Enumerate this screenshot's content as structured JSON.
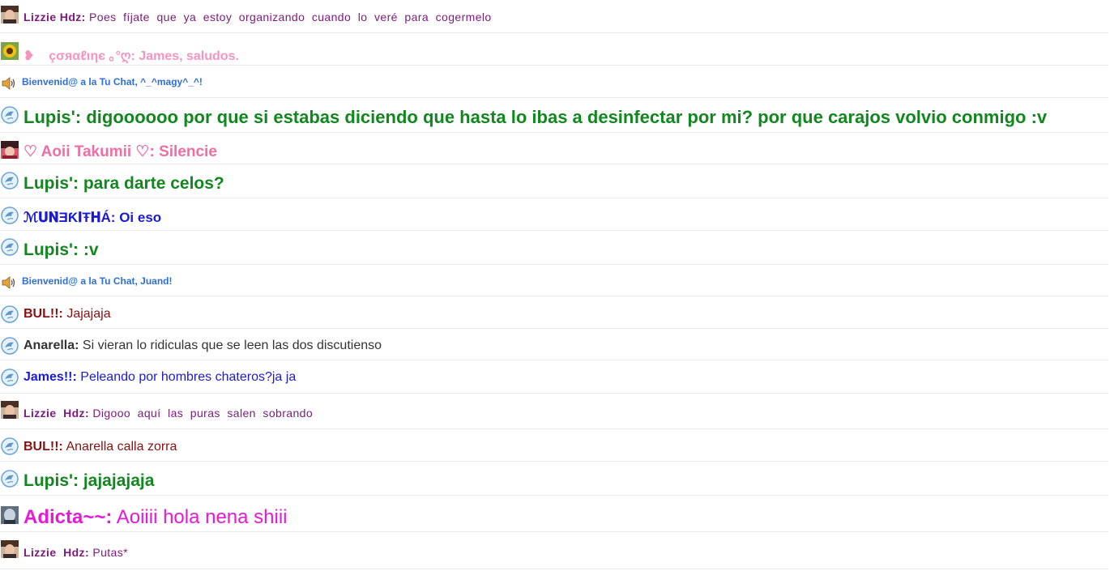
{
  "chat": {
    "messages": [
      {
        "user": "Lizzie  Hdz:",
        "text": "Poes  fíjate  que  ya  estoy  organizando  cuando  lo  veré  para  cogermelo",
        "icon": "avatar-photo",
        "name_color": "#7d1a7d",
        "text_color": "#7d1a7d"
      },
      {
        "user": "❥    çσяαℓιηє ｡°ღ:",
        "text": "James, saludos.",
        "icon": "sunflower-avatar",
        "name_color": "#f594c0",
        "text_color": "#f594c0"
      },
      {
        "text": "Bienvenid@ a la Tu Chat, ^_^magy^_^!",
        "icon": "speaker-icon",
        "system": true,
        "text_color": "#2e6fd6"
      },
      {
        "user": "Lupis':",
        "text": "digoooooo por que si estabas diciendo que hasta lo ibas a desinfectar por mi? por que carajos volvio conmigo :v",
        "icon": "dolphin-icon",
        "name_color": "#12861f",
        "text_color": "#12861f"
      },
      {
        "user": "♡ Aoii Takumii ♡:",
        "text": "Silencie",
        "icon": "avatar-photo",
        "name_color": "#ee6fa1",
        "text_color": "#ee6fa1"
      },
      {
        "user": "Lupis':",
        "text": "para darte celos?",
        "icon": "dolphin-icon",
        "name_color": "#12861f",
        "text_color": "#12861f"
      },
      {
        "user": "ℳ𝐔𝐍̀ƎƘ𝐈Ŧ𝐇Á:",
        "text": "Oi eso",
        "icon": "dolphin-icon",
        "name_color": "#1a1ad6",
        "text_color": "#1a1ad6"
      },
      {
        "user": "Lupis':",
        "text": ":v",
        "icon": "dolphin-icon",
        "name_color": "#12861f",
        "text_color": "#12861f"
      },
      {
        "text": "Bienvenid@ a la Tu Chat, Juand!",
        "icon": "speaker-icon",
        "system": true,
        "text_color": "#2e6fd6"
      },
      {
        "user": "BUL!!:",
        "text": "Jajajaja",
        "icon": "dolphin-icon",
        "name_color": "#8b1010",
        "text_color": "#8b1010"
      },
      {
        "user": "Anarella:",
        "text": "Si vieran lo ridiculas que se leen las dos discutienso",
        "icon": "dolphin-icon",
        "name_color": "#333333",
        "text_color": "#333333"
      },
      {
        "user": "James!!:",
        "text": "Peleando por hombres chateros?ja ja",
        "icon": "dolphin-icon",
        "name_color": "#1a1ad6",
        "text_color": "#1a1ad6"
      },
      {
        "user": "Lizzie  Hdz:",
        "text": "Digooo  aquí  las  puras  salen  sobrando",
        "icon": "avatar-photo",
        "name_color": "#7d1a7d",
        "text_color": "#7d1a7d"
      },
      {
        "user": "BUL!!:",
        "text": "Anarella calla zorra",
        "icon": "dolphin-icon",
        "name_color": "#8b1010",
        "text_color": "#8b1010"
      },
      {
        "user": "Lupis':",
        "text": "jajajajaja",
        "icon": "dolphin-icon",
        "name_color": "#12861f",
        "text_color": "#12861f"
      },
      {
        "user": "Adicta~~:",
        "text": "Aoiiii hola nena shiii",
        "icon": "avatar-photo",
        "name_color": "#e619d6",
        "text_color": "#e619d6"
      },
      {
        "user": "Lizzie  Hdz:",
        "text": "Putas*",
        "icon": "avatar-photo",
        "name_color": "#7d1a7d",
        "text_color": "#7d1a7d"
      }
    ]
  }
}
